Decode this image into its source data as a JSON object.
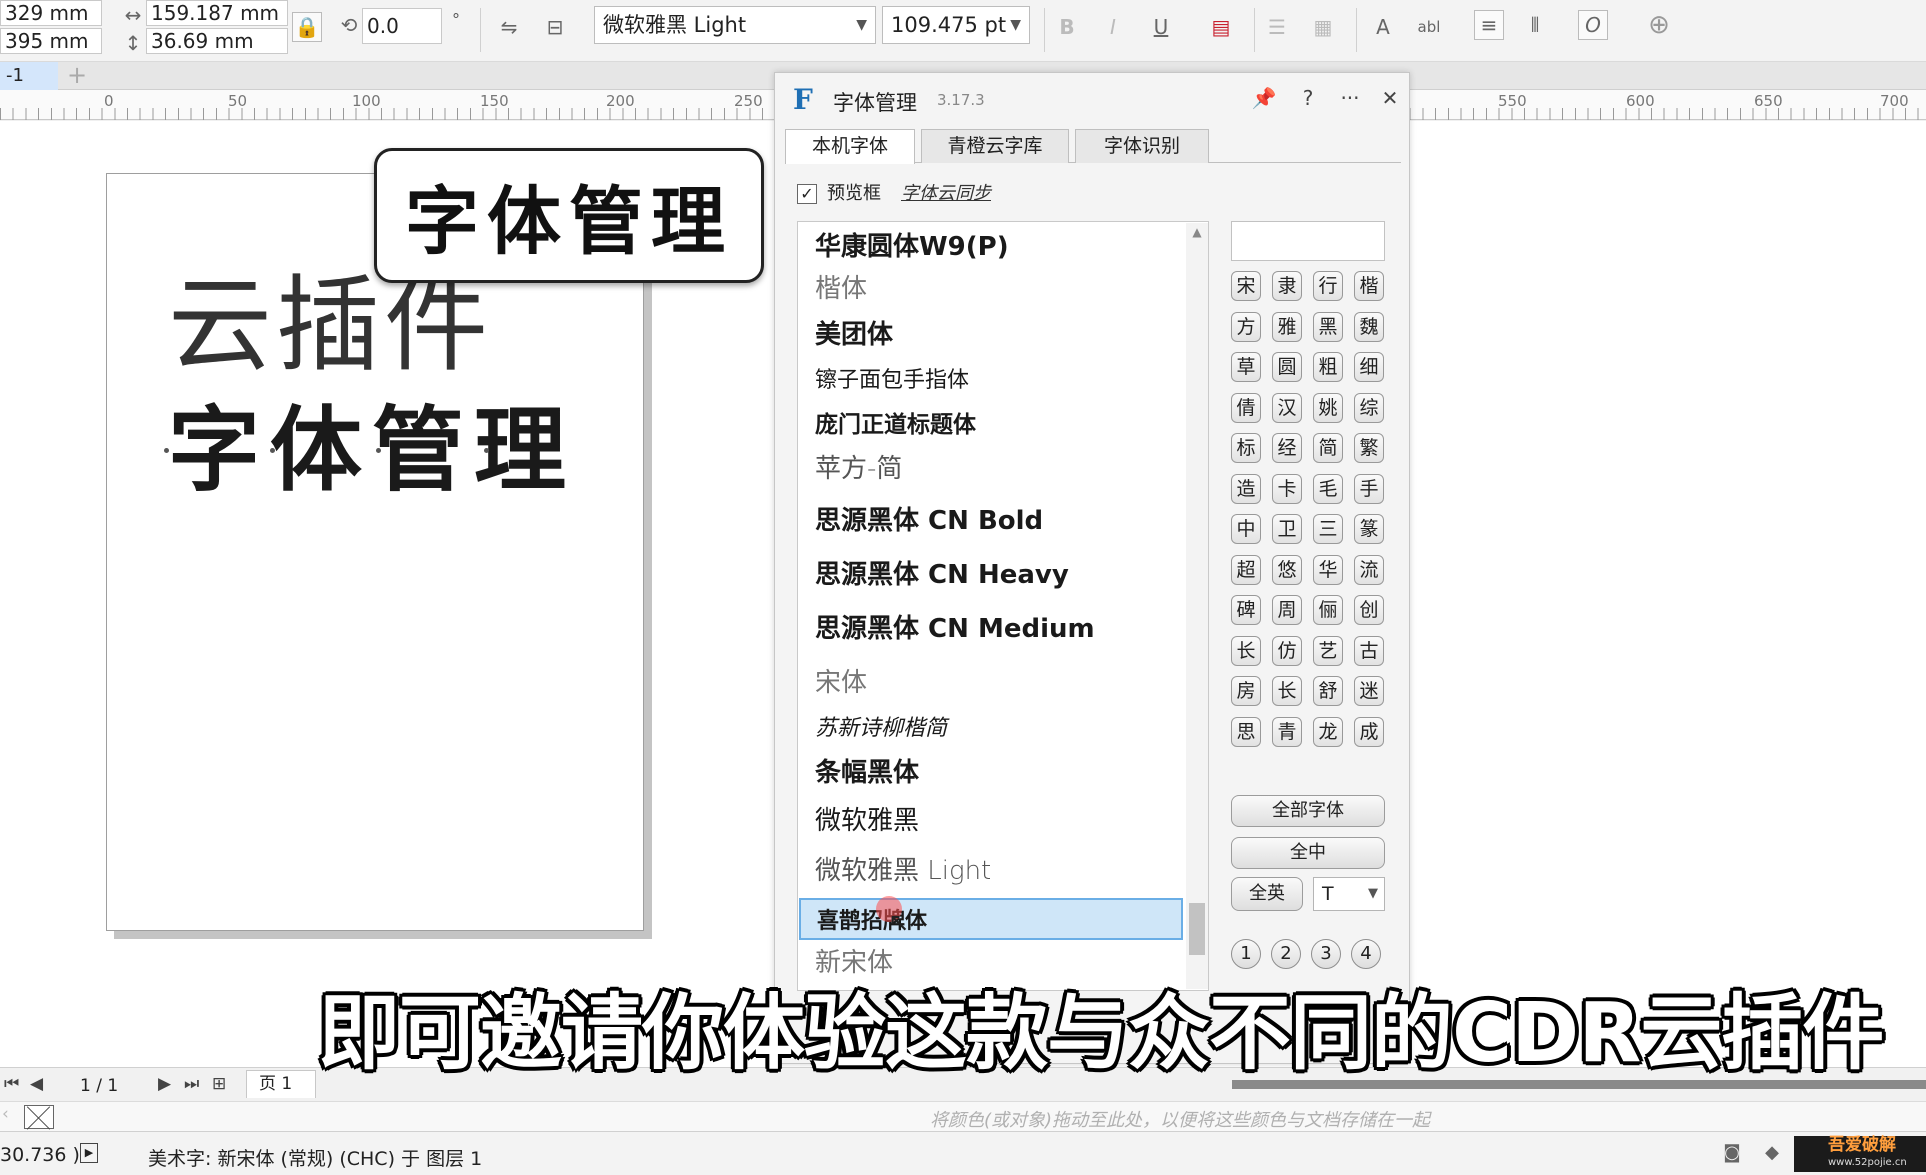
{
  "propbar": {
    "pos_x": "329 mm",
    "pos_y": "395 mm",
    "width": "159.187 mm",
    "height": "36.69 mm",
    "rotation": "0.0",
    "degree_symbol": "°",
    "font_family": "微软雅黑 Light",
    "font_size": "109.475 pt"
  },
  "doc_tab": "-1",
  "ruler_labels": [
    "0",
    "50",
    "100",
    "150",
    "200",
    "250",
    "550",
    "600",
    "650",
    "700"
  ],
  "canvas": {
    "art_light": "云插件",
    "art_bold": "字体管理",
    "callout": "字体管理"
  },
  "panel": {
    "title": "字体管理",
    "version": "3.17.3",
    "tabs": [
      "本机字体",
      "青橙云字库",
      "字体识别"
    ],
    "preview_label": "预览框",
    "sync_link": "字体云同步",
    "fonts": [
      "华康圆体W9(P)",
      "楷体",
      "美团体",
      "镲子面包手指体",
      "庞门正道标题体",
      "苹方-简",
      "思源黑体 CN Bold",
      "思源黑体 CN Heavy",
      "思源黑体 CN Medium",
      "宋体",
      "苏新诗柳楷简",
      "条幅黑体",
      "微软雅黑",
      "微软雅黑 Light",
      "喜鹊招牌体",
      "新宋体"
    ],
    "selected_font": "喜鹊招牌体",
    "categories": [
      "宋",
      "隶",
      "行",
      "楷",
      "方",
      "雅",
      "黑",
      "魏",
      "草",
      "圆",
      "粗",
      "细",
      "倩",
      "汉",
      "姚",
      "综",
      "标",
      "经",
      "简",
      "繁",
      "造",
      "卡",
      "毛",
      "手",
      "中",
      "卫",
      "三",
      "篆",
      "超",
      "悠",
      "华",
      "流",
      "碑",
      "周",
      "俪",
      "创",
      "长",
      "仿",
      "艺",
      "古",
      "房",
      "长",
      "舒",
      "迷",
      "思",
      "青",
      "龙",
      "成"
    ],
    "all_fonts_btn": "全部字体",
    "all_cn_btn": "全中",
    "all_en_btn": "全英",
    "t_select": "T",
    "pages": [
      "1",
      "2",
      "3",
      "4"
    ]
  },
  "pagebar": {
    "count": "1 / 1",
    "page_tab": "页 1"
  },
  "colorbar_hint": "将颜色(或对象)拖动至此处，以便将这些颜色与文档存储在一起",
  "status": {
    "coord": "30.736 )",
    "text": "美术字: 新宋体 (常规) (CHC) 于 图层 1"
  },
  "watermark": {
    "title": "吾爱破解",
    "url": "www.52pojie.cn"
  },
  "subtitle": "即可邀请你体验这款与众不同的CDR云插件",
  "colors": {
    "accent": "#1f6fb4",
    "selection_bg": "#cfe6f8",
    "selection_border": "#6aaee6"
  }
}
